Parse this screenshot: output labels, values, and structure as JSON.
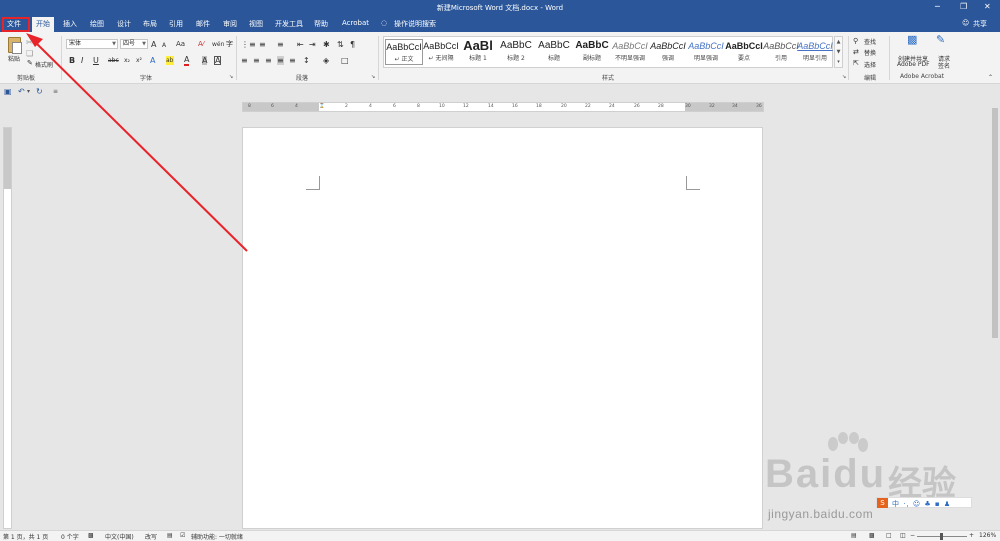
{
  "window": {
    "title": "新建Microsoft Word 文档.docx - Word",
    "minimize": "─",
    "restore": "❐",
    "close": "✕"
  },
  "menu": {
    "tabs": [
      "文件",
      "开始",
      "插入",
      "绘图",
      "设计",
      "布局",
      "引用",
      "邮件",
      "审阅",
      "视图",
      "开发工具",
      "帮助",
      "Acrobat"
    ],
    "active_tab": "开始",
    "tell_me": "操作说明搜索",
    "share": "共享"
  },
  "ribbon": {
    "clipboard": {
      "label": "剪贴板",
      "paste": "粘贴",
      "format_painter": "格式刷"
    },
    "font": {
      "label": "字体",
      "font_name": "宋体",
      "font_size": "四号",
      "grow": "A",
      "shrink": "A",
      "case": "Aa",
      "bold": "B",
      "italic": "I",
      "underline": "U",
      "strike": "abc",
      "subscript": "x₂",
      "superscript": "x²",
      "highlight": "ab",
      "font_color": "A",
      "char_shading": "A",
      "char_border": "A",
      "wen": "wén",
      "enclose": "字"
    },
    "paragraph": {
      "label": "段落"
    },
    "styles": {
      "label": "样式",
      "items": [
        {
          "sample": "AaBbCcI",
          "name": "正文"
        },
        {
          "sample": "AaBbCcI",
          "name": "无间隔"
        },
        {
          "sample": "AaBl",
          "name": "标题 1"
        },
        {
          "sample": "AaBbC",
          "name": "标题 2"
        },
        {
          "sample": "AaBbC",
          "name": "标题"
        },
        {
          "sample": "AaBbC",
          "name": "副标题"
        },
        {
          "sample": "AaBbCcI",
          "name": "不明显强调"
        },
        {
          "sample": "AaBbCcI",
          "name": "强调"
        },
        {
          "sample": "AaBbCcI",
          "name": "明显强调"
        },
        {
          "sample": "AaBbCcI",
          "name": "要点"
        },
        {
          "sample": "AaBbCcI",
          "name": "引用"
        },
        {
          "sample": "AaBbCcI",
          "name": "明显引用"
        }
      ]
    },
    "editing": {
      "label": "编辑",
      "find": "查找",
      "replace": "替换",
      "select": "选择"
    },
    "acrobat": {
      "label": "Adobe Acrobat",
      "create_share_1": "创建并共享",
      "create_share_2": "Adobe PDF",
      "request_sign_1": "请求",
      "request_sign_2": "签名"
    }
  },
  "ruler": {
    "ticks": [
      "8",
      "6",
      "4",
      "2",
      "2",
      "4",
      "6",
      "8",
      "10",
      "12",
      "14",
      "16",
      "18",
      "20",
      "22",
      "24",
      "26",
      "28",
      "30",
      "32",
      "34",
      "36",
      "38"
    ]
  },
  "status": {
    "page": "第 1 页，共 1 页",
    "words": "0 个字",
    "language": "中文(中国)",
    "mode": "改写",
    "accessibility": "辅助功能: 一切就绪",
    "zoom": "126%"
  },
  "watermark": {
    "brand": "Bai",
    "brand2": "du",
    "cn": "经验",
    "url": "jingyan.baidu.com",
    "s_badge": "S",
    "toolbar": "中 ·, ☺ ♣ ▪ ♟"
  },
  "colors": {
    "title_bar": "#2b579a",
    "highlight": "#e8232a"
  }
}
